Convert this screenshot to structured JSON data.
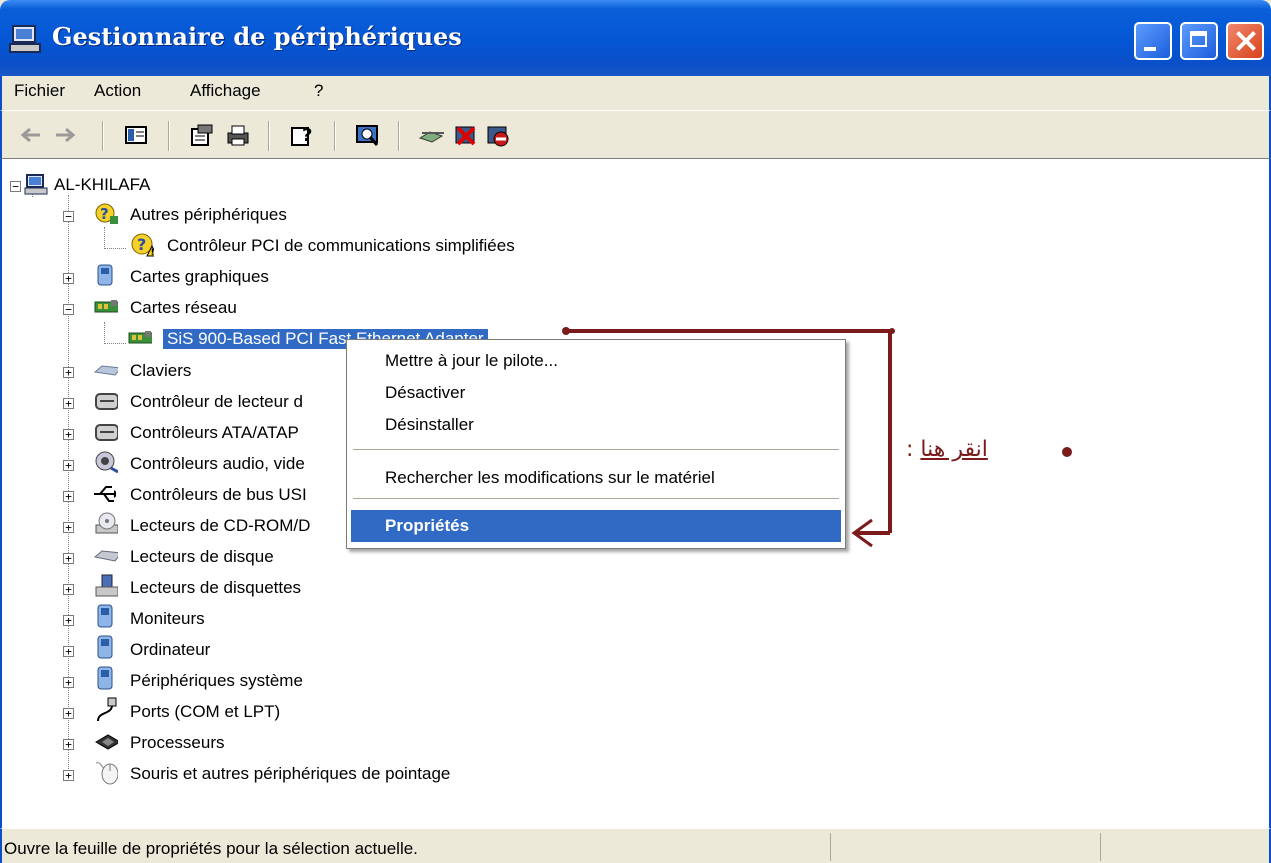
{
  "window": {
    "title": "Gestionnaire de périphériques",
    "title_icon": "device-manager-icon",
    "controls": [
      "minimize-icon",
      "maximize-icon",
      "close-icon"
    ]
  },
  "menu": {
    "items": [
      "Fichier",
      "Action",
      "Affichage",
      "?"
    ]
  },
  "toolbar": {
    "buttons": [
      "back-icon",
      "forward-icon",
      "show-hide-console-tree-icon",
      "properties-icon",
      "print-icon",
      "help-icon",
      "scan-hardware-icon",
      "update-driver-icon",
      "uninstall-icon",
      "disable-icon"
    ]
  },
  "tree": {
    "root": "AL-KHILAFA",
    "nodes": [
      {
        "label": "Autres périphériques",
        "icon": "unknown-device-icon"
      },
      {
        "label": "Contrôleur PCI de communications simplifiées",
        "icon": "warning-device-icon"
      },
      {
        "label": "Cartes graphiques",
        "icon": "display-adapter-icon"
      },
      {
        "label": "Cartes réseau",
        "icon": "network-card-icon"
      },
      {
        "label": "SiS 900-Based PCI Fast Ethernet Adapter",
        "icon": "network-card-icon"
      },
      {
        "label": "Claviers",
        "icon": "keyboard-icon"
      },
      {
        "label": "Contrôleur de lecteur d",
        "icon": "drive-controller-icon"
      },
      {
        "label": "Contrôleurs ATA/ATAP",
        "icon": "ide-controller-icon"
      },
      {
        "label": "Contrôleurs audio, vide",
        "icon": "audio-icon"
      },
      {
        "label": "Contrôleurs de bus USI",
        "icon": "usb-icon"
      },
      {
        "label": "Lecteurs de CD-ROM/D",
        "icon": "cdrom-icon"
      },
      {
        "label": "Lecteurs de disque",
        "icon": "disk-drive-icon"
      },
      {
        "label": "Lecteurs de disquettes",
        "icon": "floppy-icon"
      },
      {
        "label": "Moniteurs",
        "icon": "monitor-icon"
      },
      {
        "label": "Ordinateur",
        "icon": "computer-icon"
      },
      {
        "label": "Périphériques système",
        "icon": "system-device-icon"
      },
      {
        "label": "Ports (COM et LPT)",
        "icon": "port-icon"
      },
      {
        "label": "Processeurs",
        "icon": "processor-icon"
      },
      {
        "label": "Souris et autres périphériques de pointage",
        "icon": "mouse-icon"
      }
    ]
  },
  "context_menu": {
    "update_driver": "Mettre à jour le pilote...",
    "disable": "Désactiver",
    "uninstall": "Désinstaller",
    "scan": "Rechercher les modifications sur le matériel",
    "properties": "Propriétés"
  },
  "annotation": {
    "text": "انقر هنا",
    "color": "#7b1b1b"
  },
  "status": {
    "text": "Ouvre la feuille de propriétés pour la sélection actuelle."
  },
  "colors": {
    "title_bar": "#0556d4",
    "selection": "#316ac5",
    "window_bg": "#ece9d8"
  }
}
